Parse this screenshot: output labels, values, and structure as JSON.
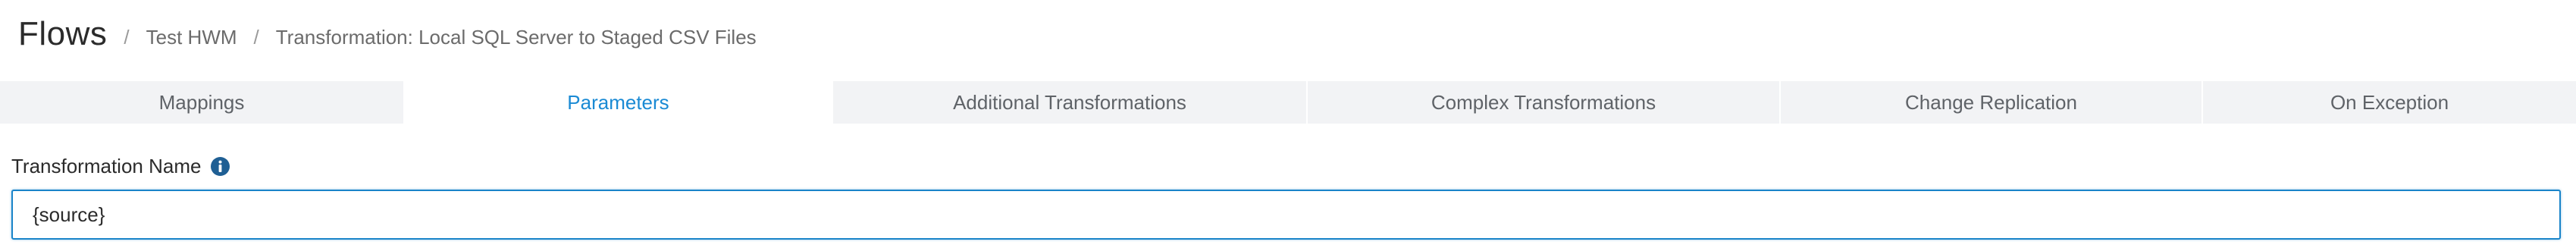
{
  "header": {
    "title": "Flows",
    "separator": "/",
    "breadcrumbs": [
      "Test HWM",
      "Transformation: Local SQL Server to Staged CSV Files"
    ]
  },
  "tabs": [
    {
      "label": "Mappings",
      "active": false
    },
    {
      "label": "Parameters",
      "active": true
    },
    {
      "label": "Additional Transformations",
      "active": false
    },
    {
      "label": "Complex Transformations",
      "active": false
    },
    {
      "label": "Change Replication",
      "active": false
    },
    {
      "label": "On Exception",
      "active": false
    }
  ],
  "form": {
    "transformation_name": {
      "label": "Transformation Name",
      "value": "{source}",
      "info_icon": "info-circle-icon"
    }
  },
  "colors": {
    "accent": "#1a8ad4",
    "tab_background": "#f2f3f5",
    "input_border": "#1a84c9",
    "info_icon": "#1f5f94"
  }
}
